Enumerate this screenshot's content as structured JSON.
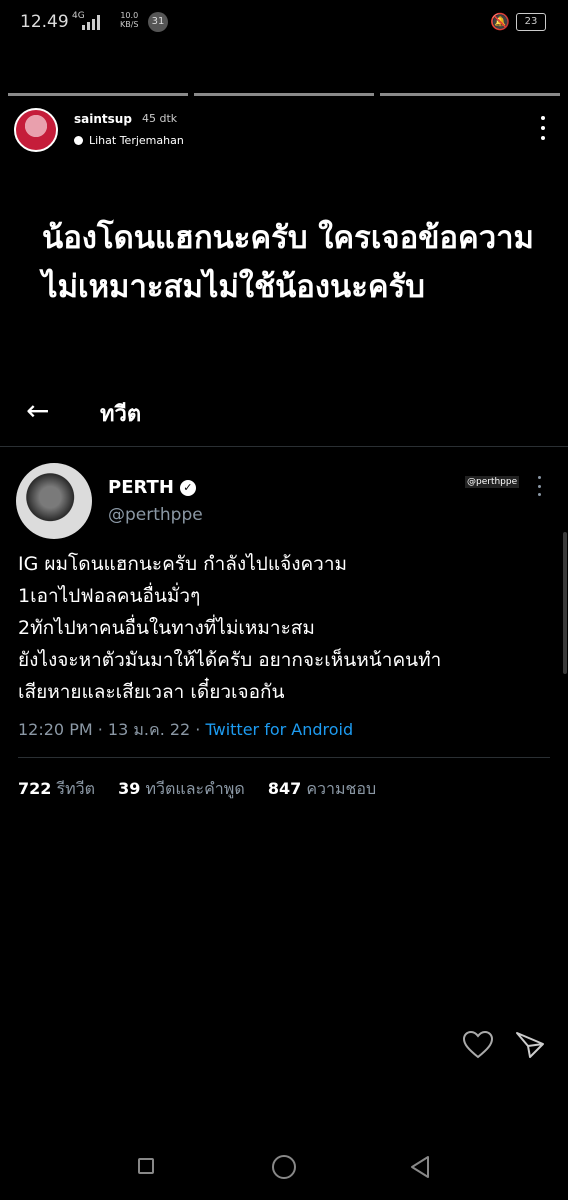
{
  "status_bar": {
    "time": "12.49",
    "network": "4G",
    "speed_value": "10.0",
    "speed_unit": "KB/S",
    "notification_count": "31",
    "battery": "23"
  },
  "story": {
    "username": "saintsup",
    "time_ago": "45 dtk",
    "translate_label": "Lihat Terjemahan",
    "caption": "น้องโดนแฮกนะครับ ใครเจอข้อความไม่เหมาะสมไม่ใช้น้องนะครับ"
  },
  "twitter": {
    "header_title": "ทวีต",
    "author_name": "PERTH",
    "author_handle": "@perthppe",
    "watermark": "@perthppe",
    "body_lines": [
      "IG ผมโดนแฮกนะครับ กำลังไปแจ้งความ",
      "1เอาไปฟอลคนอื่นมั่วๆ",
      "2ทักไปหาคนอื่นในทางที่ไม่เหมาะสม",
      "ยังไงจะหาตัวมันมาให้ได้ครับ อยากจะเห็นหน้าคนทำ",
      "เสียหายและเสียเวลา เดี๋ยวเจอกัน"
    ],
    "meta_time": "12:20 PM · 13 ม.ค. 22 · ",
    "meta_source": "Twitter for Android",
    "stats": {
      "retweets": "722",
      "retweets_label": "รีทวีต",
      "quotes": "39",
      "quotes_label": "ทวีตและคำพูด",
      "likes": "847",
      "likes_label": "ความชอบ"
    }
  },
  "icons": {
    "heart": "heart-icon",
    "send": "send-icon",
    "back": "arrow-left-icon"
  }
}
